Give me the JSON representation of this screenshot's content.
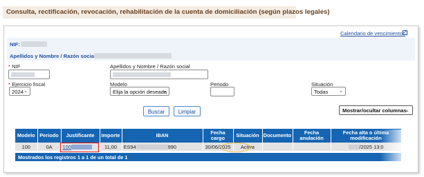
{
  "page_title": "Consulta, rectificación, revocación, rehabilitación de la cuenta de domiciliación (según plazos legales)",
  "calendar_link": "Calendario de vencimientos",
  "info": {
    "nif_label": "NIF:",
    "name_label": "Apellidos y Nombre / Razón social:"
  },
  "form": {
    "nif_label": "NIF",
    "name_label": "Apellidos y Nombre / Razón social",
    "ejercicio_label": "Ejercicio fiscal",
    "ejercicio_value": "2024",
    "modelo_label": "Modelo",
    "modelo_value": "Elija la opción deseada",
    "periodo_label": "Periodo",
    "situacion_label": "Situación",
    "situacion_value": "Todas",
    "required_mark": "*"
  },
  "buttons": {
    "search": "Buscar",
    "clear": "Limpiar",
    "show_hide_columns": "Mostrar/ocultar columnas"
  },
  "table": {
    "headers": [
      "Modelo",
      "Periodo",
      "Justificante",
      "Importe",
      "IBAN",
      "Fecha cargo",
      "Situación",
      "Documento",
      "Fecha anulación",
      "Fecha alta o última modificación"
    ],
    "rows": [
      {
        "modelo": "100",
        "periodo": "0A",
        "justificante": "100",
        "importe": "11,00",
        "iban_start": "ES94",
        "iban_end": "990",
        "fecha_cargo": "30/06/2025",
        "situacion": "Activa",
        "documento": "",
        "fecha_anulacion": "",
        "fecha_alta": "/2025 13:0"
      }
    ],
    "footer": "Mostrados los registros 1 a 1 de un total de 1"
  },
  "colors": {
    "header_blue": "#1565b3",
    "link_blue": "#1f4fa0",
    "title_bg": "#f4ece2",
    "highlight_red": "#e01010",
    "highlight_yellow": "#e8b63a"
  },
  "icons": {
    "calendar_link_icon": "external-link-icon",
    "select_chevron": "chevron-down-icon"
  }
}
